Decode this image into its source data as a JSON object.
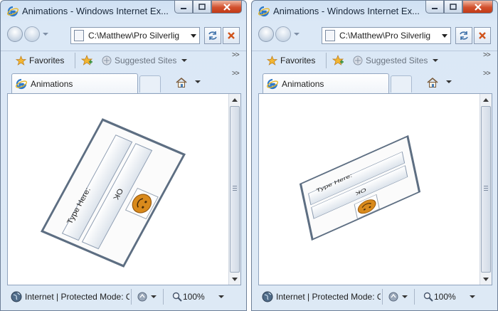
{
  "windows": [
    {
      "title": "Animations - Windows Internet Ex...",
      "address": "C:\\Matthew\\Pro Silverlig",
      "favorites_label": "Favorites",
      "suggested_sites_label": "Suggested Sites",
      "tab_label": "Animations",
      "panel": {
        "input_label": "Type Here:",
        "button_label": "OK"
      },
      "status_text": "Internet | Protected Mode: Off",
      "zoom_level": "100%"
    },
    {
      "title": "Animations - Windows Internet Ex...",
      "address": "C:\\Matthew\\Pro Silverlig",
      "favorites_label": "Favorites",
      "suggested_sites_label": "Suggested Sites",
      "tab_label": "Animations",
      "panel": {
        "input_label": "Type Here:",
        "button_label": "OK"
      },
      "status_text": "Internet | Protected Mode: Off",
      "zoom_level": "100%"
    }
  ],
  "icons": {
    "browser": "ie-logo-icon",
    "back": "back-icon",
    "forward": "forward-icon",
    "refresh": "refresh-icon",
    "stop": "stop-icon",
    "favorites": "star-icon",
    "add_favorite": "add-favorite-icon",
    "suggested": "suggested-sites-icon",
    "home": "home-icon",
    "status": "globe-icon",
    "zoom": "zoom-icon",
    "content_image": "smiley-icon"
  },
  "colors": {
    "title_bar": "#cfe0f3",
    "close_button": "#c23a16",
    "panel_border": "#5d6e82",
    "smiley": "#d98a1c"
  }
}
